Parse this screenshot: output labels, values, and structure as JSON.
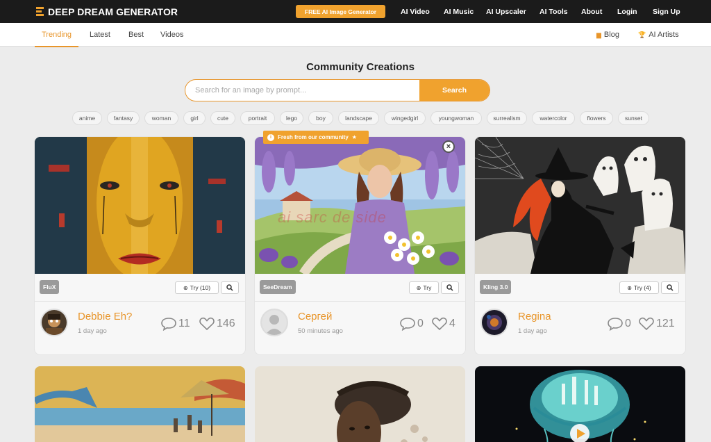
{
  "header": {
    "logo_text": "DEEP DREAM GENERATOR",
    "cta_label": "FREE AI Image Generator",
    "nav": [
      "AI Video",
      "AI Music",
      "AI Upscaler",
      "AI Tools",
      "About",
      "Login",
      "Sign Up"
    ]
  },
  "subnav": {
    "tabs": [
      "Trending",
      "Latest",
      "Best",
      "Videos"
    ],
    "active_tab": "Trending",
    "blog_label": "Blog",
    "artists_label": "AI Artists"
  },
  "main": {
    "title": "Community Creations",
    "search_placeholder": "Search for an image by prompt...",
    "search_button": "Search",
    "tags": [
      "anime",
      "fantasy",
      "woman",
      "girl",
      "cute",
      "portrait",
      "lego",
      "boy",
      "landscape",
      "wingedgirl",
      "youngwoman",
      "surrealism",
      "watercolor",
      "flowers",
      "sunset"
    ]
  },
  "banner": {
    "fresh_text": "Fresh from our community",
    "watermark": "ai sarc de side"
  },
  "cards": [
    {
      "model": "FluX",
      "try_label": "Try (10)",
      "user": "Debbie Eh?",
      "time": "1 day ago",
      "comments": "11",
      "likes": "146"
    },
    {
      "model": "SeeDream",
      "try_label": "Try",
      "user": "Сергей",
      "time": "50 minutes ago",
      "comments": "0",
      "likes": "4"
    },
    {
      "model": "Kling 3.0",
      "try_label": "Try (4)",
      "user": "Regina",
      "time": "1 day ago",
      "comments": "0",
      "likes": "121"
    }
  ],
  "colors": {
    "accent": "#f0a22e",
    "topbar": "#1b1b1b",
    "background": "#ececec"
  }
}
